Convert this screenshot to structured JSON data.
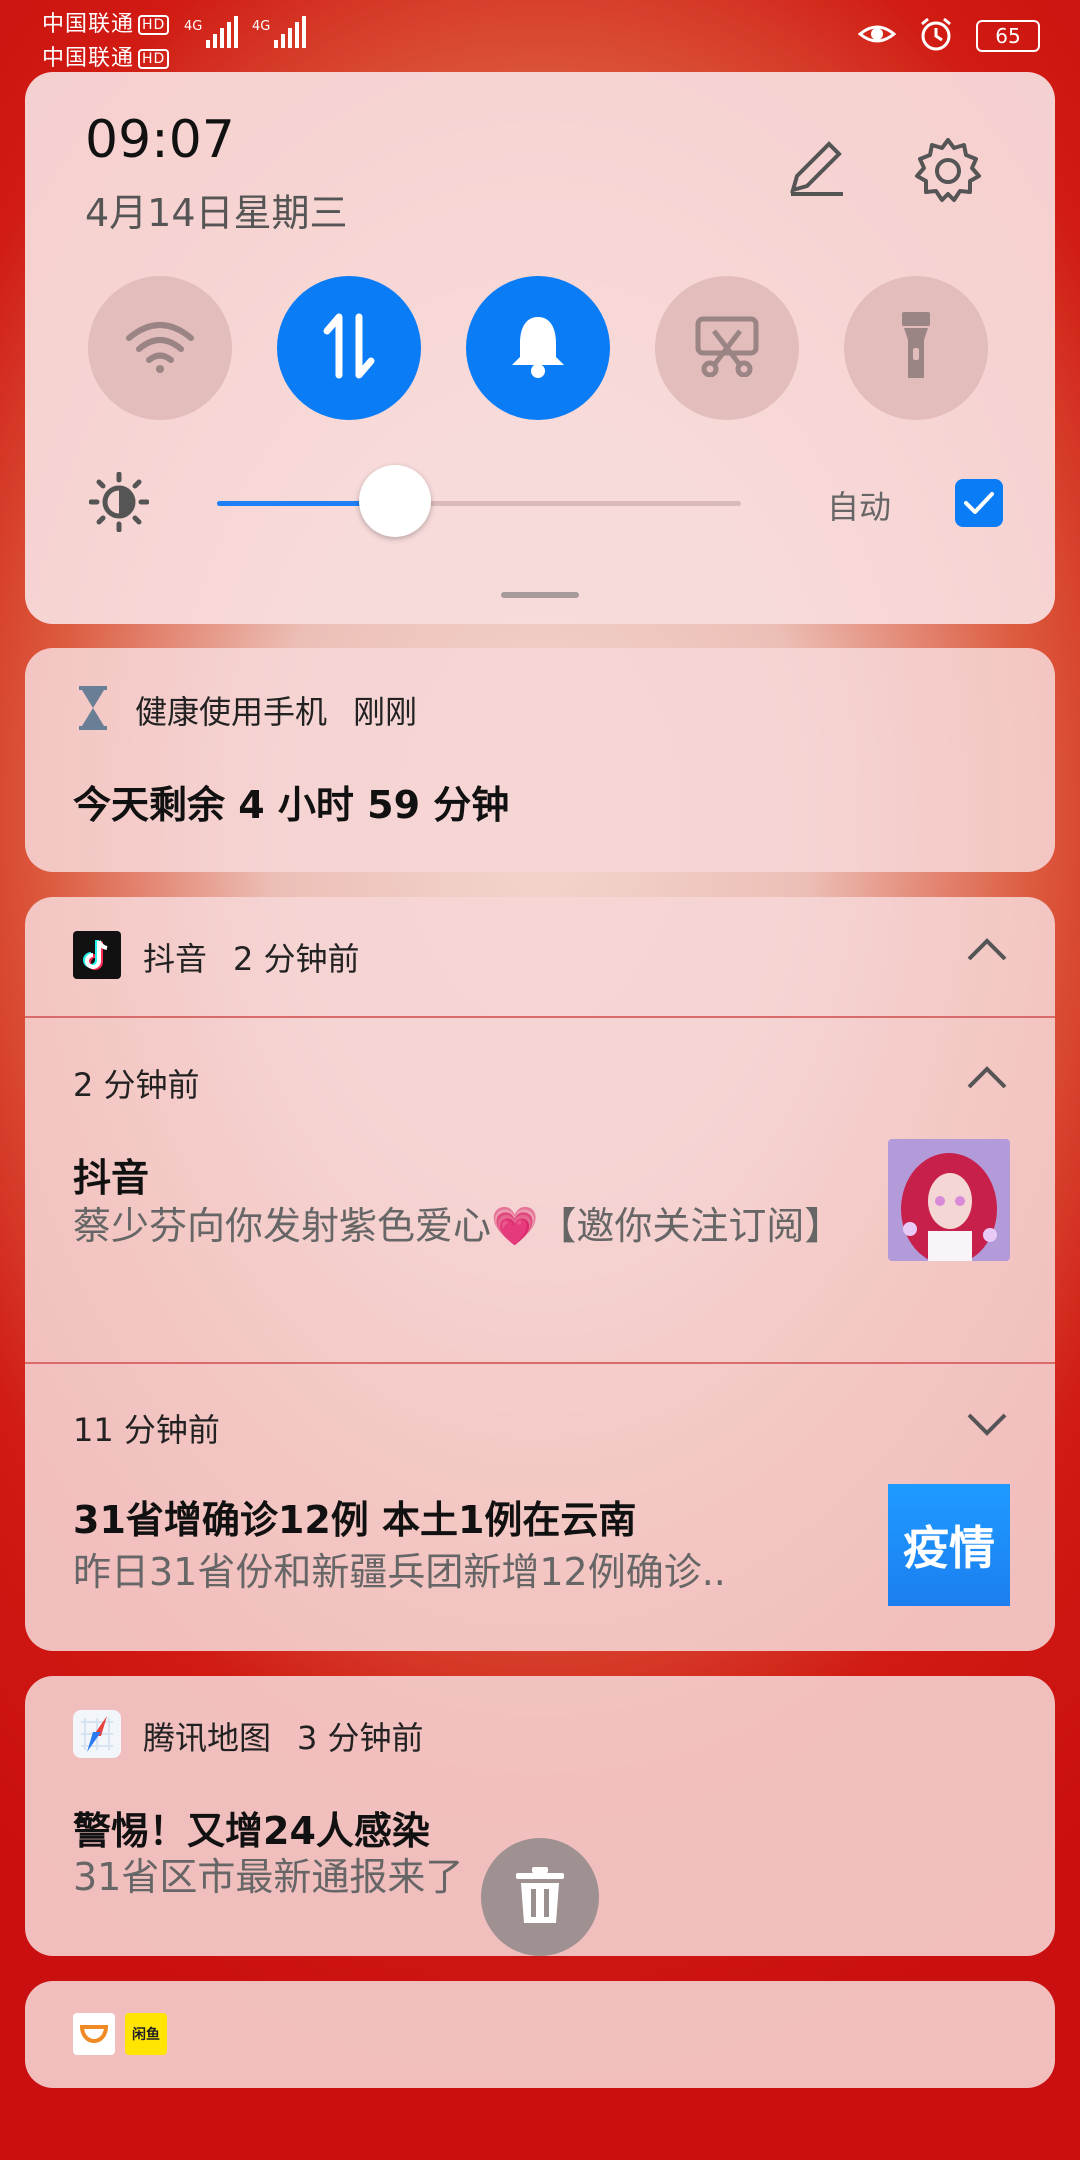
{
  "status_bar": {
    "carrier1": "中国联通",
    "carrier2": "中国联通",
    "hd": "HD",
    "net1": "4G",
    "net2": "4G",
    "battery": "65"
  },
  "quick_settings": {
    "time": "09:07",
    "date": "4月14日星期三",
    "toggles": [
      {
        "name": "wifi",
        "on": false
      },
      {
        "name": "mobile-data",
        "on": true
      },
      {
        "name": "sound",
        "on": true
      },
      {
        "name": "screenshot",
        "on": false
      },
      {
        "name": "flashlight",
        "on": false
      }
    ],
    "brightness_level": 0.34,
    "auto_label": "自动",
    "auto_checked": true
  },
  "notifications": {
    "health": {
      "app": "健康使用手机",
      "time": "刚刚",
      "title": "今天剩余 4 小时 59 分钟"
    },
    "douyin": {
      "app": "抖音",
      "time": "2 分钟前",
      "items": [
        {
          "time": "2 分钟前",
          "title": "抖音",
          "body": "蔡少芬向你发射紫色爱心💗【邀你关注订阅】"
        },
        {
          "time": "11 分钟前",
          "title": "31省增确诊12例 本土1例在云南",
          "body": "昨日31省份和新疆兵团新增12例确诊..",
          "thumb_text": "疫情"
        }
      ]
    },
    "tencent_map": {
      "app": "腾讯地图",
      "time": "3 分钟前",
      "title": "警惕！又增24人感染",
      "body": "31省区市最新通报来了"
    },
    "bottom_icon_text": "闲鱼"
  },
  "colors": {
    "accent": "#0a7cf6",
    "card": "#f6d6d6",
    "background": "#c90f0f"
  }
}
